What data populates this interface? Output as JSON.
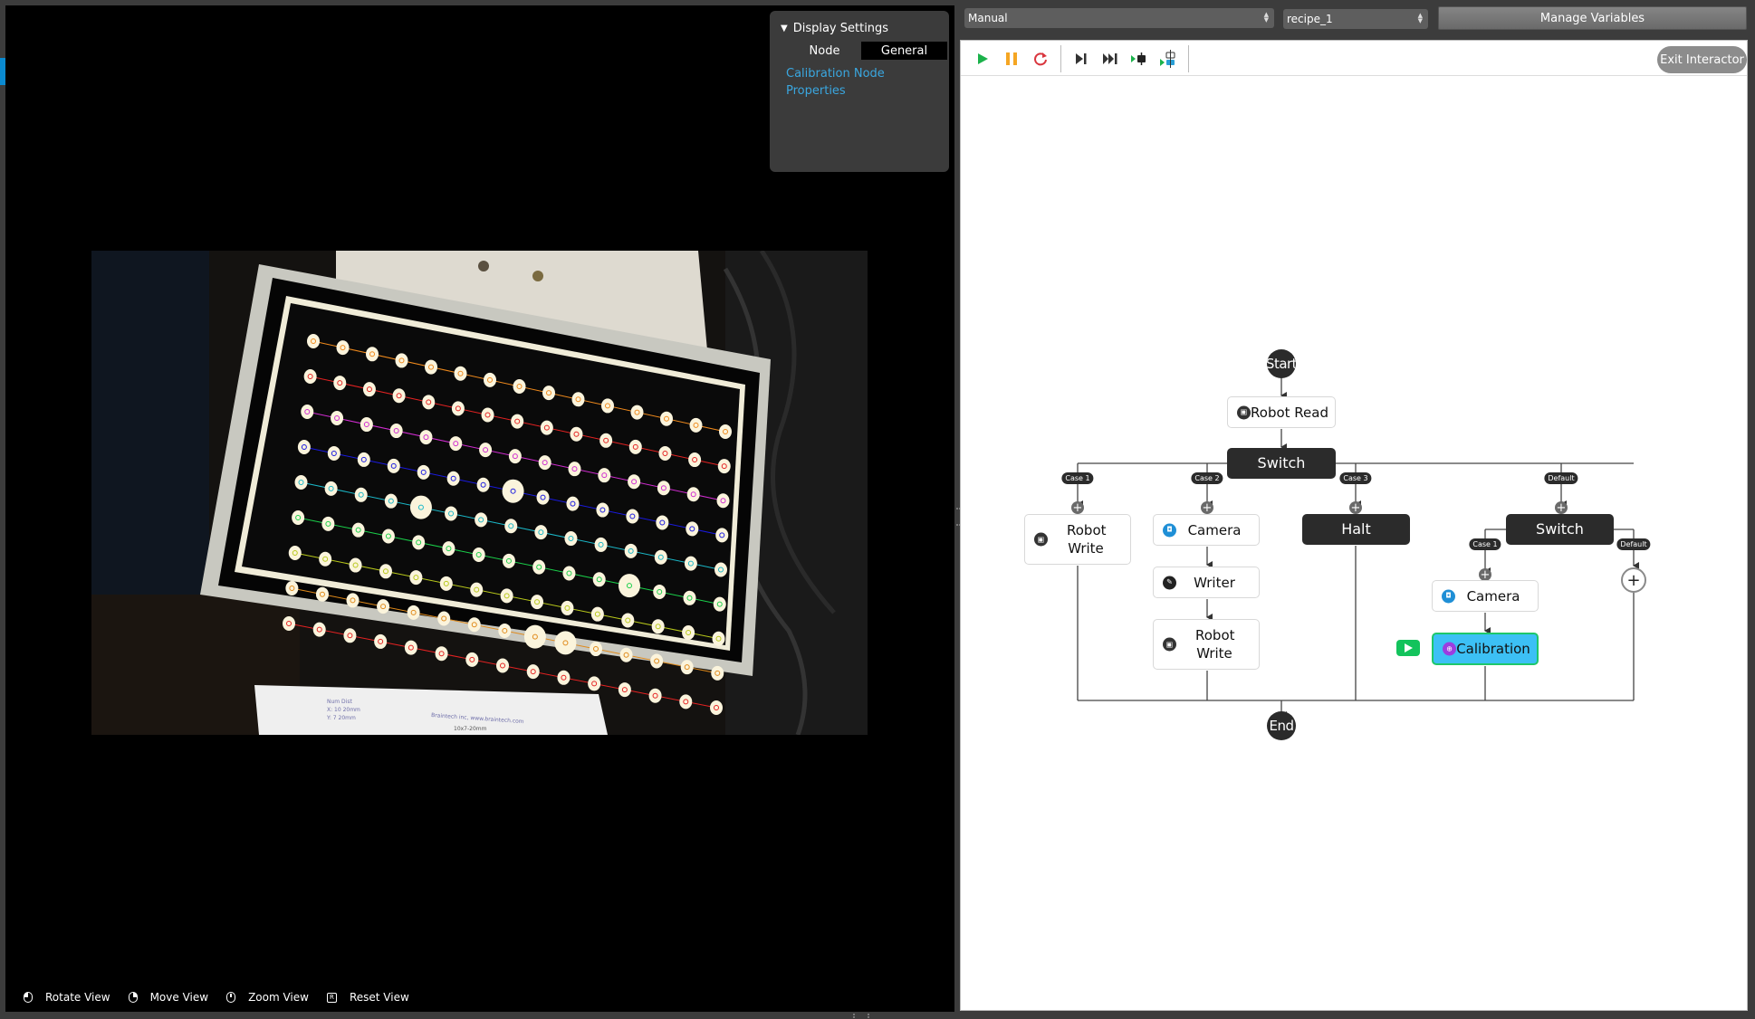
{
  "viewport": {
    "display_settings": {
      "title": "Display Settings",
      "tabs": [
        {
          "label": "Node",
          "active": false
        },
        {
          "label": "General",
          "active": true
        }
      ],
      "link": "Calibration Node Properties"
    },
    "camera_image": {
      "description": "Calibration grid plate photo with detected dot rows overlay",
      "label_lines": [
        "Num  Dist",
        "X: 10  20mm",
        "Y: 7  20mm",
        "Braintech inc, www.braintech.com",
        "10x7-20mm"
      ]
    },
    "view_toolbar": [
      {
        "icon": "mouse-left-icon",
        "label": "Rotate View"
      },
      {
        "icon": "mouse-right-icon",
        "label": "Move View"
      },
      {
        "icon": "mouse-middle-icon",
        "label": "Zoom View"
      },
      {
        "icon": "r-key-icon",
        "label": "Reset View",
        "key": "R"
      }
    ]
  },
  "header": {
    "mode_select": {
      "value": "Manual"
    },
    "recipe_select": {
      "value": "recipe_1"
    },
    "manage_variables_label": "Manage Variables"
  },
  "exec_toolbar": {
    "buttons": [
      {
        "name": "run",
        "icon": "play-icon",
        "color": "#1bb24b"
      },
      {
        "name": "pause",
        "icon": "pause-icon",
        "color": "#f5a623"
      },
      {
        "name": "reset",
        "icon": "refresh-icon",
        "color": "#d9363e"
      },
      {
        "name": "step",
        "icon": "step-icon",
        "color": "#333333"
      },
      {
        "name": "step-all",
        "icon": "fast-forward-icon",
        "color": "#333333"
      },
      {
        "name": "run-to-node",
        "icon": "run-to-node-icon",
        "color": "#333333"
      },
      {
        "name": "run-selected",
        "icon": "run-selected-icon",
        "color": "#2a9fd6"
      }
    ],
    "exit_label": "Exit Interactor"
  },
  "flow": {
    "start_label": "Start",
    "end_label": "End",
    "nodes": {
      "robot_read": {
        "label": "Robot Read",
        "icon": "robot-icon"
      },
      "switch_main": {
        "label": "Switch"
      },
      "robot_write_1": {
        "label": "Robot Write",
        "icon": "robot-icon"
      },
      "camera_1": {
        "label": "Camera",
        "icon": "camera-icon"
      },
      "writer": {
        "label": "Writer",
        "icon": "writer-icon"
      },
      "robot_write_2": {
        "label": "Robot Write",
        "icon": "robot-icon"
      },
      "halt": {
        "label": "Halt"
      },
      "switch_nested": {
        "label": "Switch"
      },
      "camera_2": {
        "label": "Camera",
        "icon": "camera-icon"
      },
      "calibration": {
        "label": "Calibration",
        "icon": "calibration-icon",
        "active": true
      }
    },
    "branches": {
      "main": [
        "Case 1",
        "Case 2",
        "Case 3",
        "Default"
      ],
      "nested": [
        "Case 1",
        "Default"
      ]
    },
    "colors": {
      "active_fill": "#3cc0f5",
      "active_border": "#1ec76b",
      "dark_node": "#2b2b2b",
      "camera_icon": "#1f8fd6",
      "calibration_icon": "#9b3de0"
    }
  }
}
